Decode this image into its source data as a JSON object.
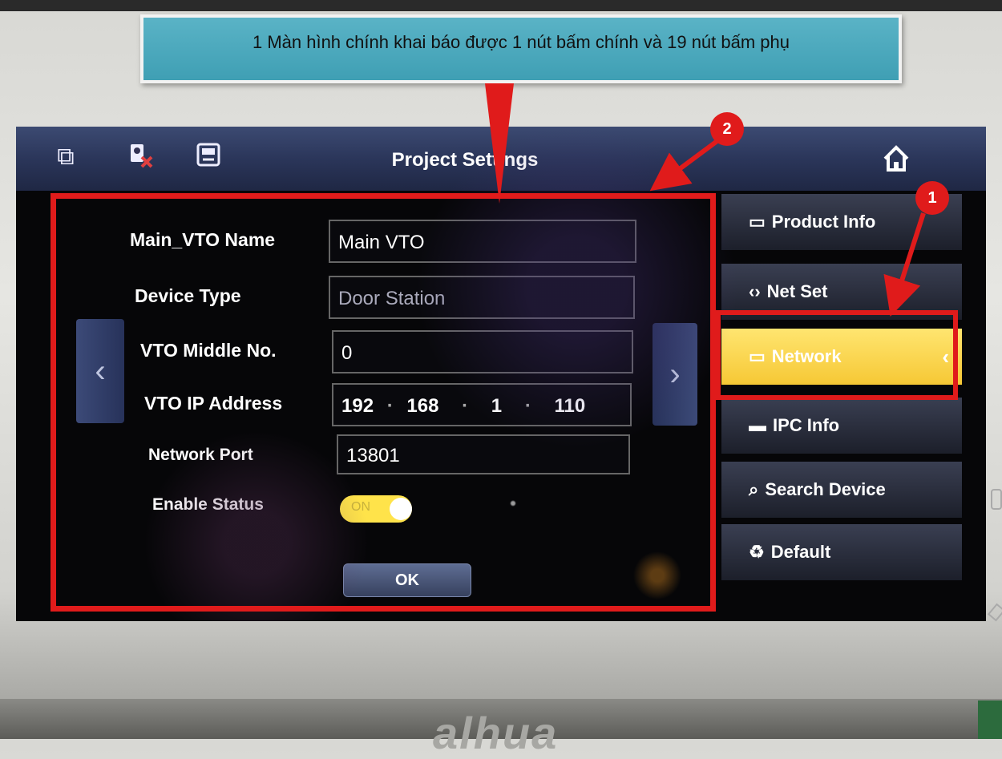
{
  "annotation": {
    "callout_text": "1 Màn hình chính khai báo được 1 nút bấm chính và 19 nút bấm phụ",
    "badge_1": "1",
    "badge_2": "2"
  },
  "device": {
    "brand": "alhua",
    "title": "Project Settings",
    "titlebar_icons": [
      "monitor-icon",
      "camera-disabled-icon",
      "sd-card-icon"
    ],
    "home_icon": "home-icon"
  },
  "form": {
    "fields": [
      {
        "label": "Main_VTO Name",
        "value": "Main VTO"
      },
      {
        "label": "Device Type",
        "value": "Door Station"
      },
      {
        "label": "VTO Middle No.",
        "value": "0"
      },
      {
        "label": "VTO IP Address",
        "ip": [
          "192",
          "168",
          "1",
          "110"
        ]
      },
      {
        "label": "Network Port",
        "value": "13801"
      }
    ],
    "enable_status_label": "Enable Status",
    "toggle_text": "ON",
    "ok_label": "OK",
    "prev_glyph": "‹",
    "next_glyph": "›"
  },
  "sidebar": {
    "items": [
      {
        "label": "Product Info",
        "icon": "monitor-icon"
      },
      {
        "label": "Net Set",
        "icon": "code-icon"
      },
      {
        "label": "Network",
        "icon": "monitor-icon",
        "active": true
      },
      {
        "label": "IPC Info",
        "icon": "camera-icon"
      },
      {
        "label": "Search Device",
        "icon": "search-device-icon"
      },
      {
        "label": "Default",
        "icon": "recycle-icon"
      }
    ]
  },
  "colors": {
    "annotation_red": "#e01b1b",
    "callout_bg": "#4aa9bd",
    "active_yellow": "#f6c835"
  }
}
